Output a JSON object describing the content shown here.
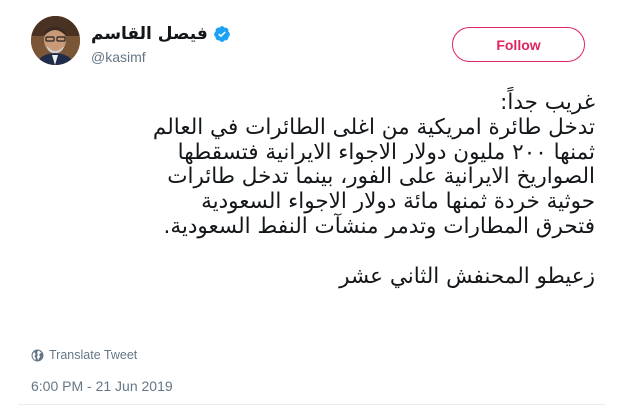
{
  "author": {
    "display_name": "فيصل القاسم",
    "handle": "@kasimf",
    "verified": true,
    "avatar_icon": "profile-photo"
  },
  "follow_button": {
    "label": "Follow",
    "color": "#e0245e"
  },
  "tweet": {
    "lines": [
      "غريب جداً:",
      "تدخل طائرة امريكية من اغلى الطائرات في العالم",
      "ثمنها ٢٠٠ مليون دولار الاجواء الايرانية فتسقطها",
      "الصواريخ الايرانية على الفور، بينما تدخل طائرات",
      "حوثية خردة ثمنها مائة دولار  الاجواء السعودية",
      "فتحرق المطارات وتدمر منشآت النفط السعودية.",
      "",
      "زعيطو المحنفش الثاني عشر"
    ]
  },
  "translate": {
    "label": "Translate Tweet",
    "icon": "globe-icon"
  },
  "timestamp": "6:00 PM - 21 Jun 2019",
  "colors": {
    "text": "#14171a",
    "secondary": "#657786",
    "verified": "#1da1f2"
  }
}
